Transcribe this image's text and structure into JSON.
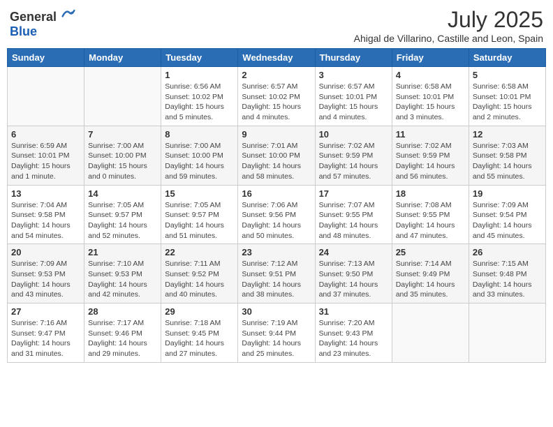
{
  "logo": {
    "general": "General",
    "blue": "Blue"
  },
  "title": "July 2025",
  "subtitle": "Ahigal de Villarino, Castille and Leon, Spain",
  "days_of_week": [
    "Sunday",
    "Monday",
    "Tuesday",
    "Wednesday",
    "Thursday",
    "Friday",
    "Saturday"
  ],
  "weeks": [
    [
      {
        "day": "",
        "info": ""
      },
      {
        "day": "",
        "info": ""
      },
      {
        "day": "1",
        "info": "Sunrise: 6:56 AM\nSunset: 10:02 PM\nDaylight: 15 hours and 5 minutes."
      },
      {
        "day": "2",
        "info": "Sunrise: 6:57 AM\nSunset: 10:02 PM\nDaylight: 15 hours and 4 minutes."
      },
      {
        "day": "3",
        "info": "Sunrise: 6:57 AM\nSunset: 10:01 PM\nDaylight: 15 hours and 4 minutes."
      },
      {
        "day": "4",
        "info": "Sunrise: 6:58 AM\nSunset: 10:01 PM\nDaylight: 15 hours and 3 minutes."
      },
      {
        "day": "5",
        "info": "Sunrise: 6:58 AM\nSunset: 10:01 PM\nDaylight: 15 hours and 2 minutes."
      }
    ],
    [
      {
        "day": "6",
        "info": "Sunrise: 6:59 AM\nSunset: 10:01 PM\nDaylight: 15 hours and 1 minute."
      },
      {
        "day": "7",
        "info": "Sunrise: 7:00 AM\nSunset: 10:00 PM\nDaylight: 15 hours and 0 minutes."
      },
      {
        "day": "8",
        "info": "Sunrise: 7:00 AM\nSunset: 10:00 PM\nDaylight: 14 hours and 59 minutes."
      },
      {
        "day": "9",
        "info": "Sunrise: 7:01 AM\nSunset: 10:00 PM\nDaylight: 14 hours and 58 minutes."
      },
      {
        "day": "10",
        "info": "Sunrise: 7:02 AM\nSunset: 9:59 PM\nDaylight: 14 hours and 57 minutes."
      },
      {
        "day": "11",
        "info": "Sunrise: 7:02 AM\nSunset: 9:59 PM\nDaylight: 14 hours and 56 minutes."
      },
      {
        "day": "12",
        "info": "Sunrise: 7:03 AM\nSunset: 9:58 PM\nDaylight: 14 hours and 55 minutes."
      }
    ],
    [
      {
        "day": "13",
        "info": "Sunrise: 7:04 AM\nSunset: 9:58 PM\nDaylight: 14 hours and 54 minutes."
      },
      {
        "day": "14",
        "info": "Sunrise: 7:05 AM\nSunset: 9:57 PM\nDaylight: 14 hours and 52 minutes."
      },
      {
        "day": "15",
        "info": "Sunrise: 7:05 AM\nSunset: 9:57 PM\nDaylight: 14 hours and 51 minutes."
      },
      {
        "day": "16",
        "info": "Sunrise: 7:06 AM\nSunset: 9:56 PM\nDaylight: 14 hours and 50 minutes."
      },
      {
        "day": "17",
        "info": "Sunrise: 7:07 AM\nSunset: 9:55 PM\nDaylight: 14 hours and 48 minutes."
      },
      {
        "day": "18",
        "info": "Sunrise: 7:08 AM\nSunset: 9:55 PM\nDaylight: 14 hours and 47 minutes."
      },
      {
        "day": "19",
        "info": "Sunrise: 7:09 AM\nSunset: 9:54 PM\nDaylight: 14 hours and 45 minutes."
      }
    ],
    [
      {
        "day": "20",
        "info": "Sunrise: 7:09 AM\nSunset: 9:53 PM\nDaylight: 14 hours and 43 minutes."
      },
      {
        "day": "21",
        "info": "Sunrise: 7:10 AM\nSunset: 9:53 PM\nDaylight: 14 hours and 42 minutes."
      },
      {
        "day": "22",
        "info": "Sunrise: 7:11 AM\nSunset: 9:52 PM\nDaylight: 14 hours and 40 minutes."
      },
      {
        "day": "23",
        "info": "Sunrise: 7:12 AM\nSunset: 9:51 PM\nDaylight: 14 hours and 38 minutes."
      },
      {
        "day": "24",
        "info": "Sunrise: 7:13 AM\nSunset: 9:50 PM\nDaylight: 14 hours and 37 minutes."
      },
      {
        "day": "25",
        "info": "Sunrise: 7:14 AM\nSunset: 9:49 PM\nDaylight: 14 hours and 35 minutes."
      },
      {
        "day": "26",
        "info": "Sunrise: 7:15 AM\nSunset: 9:48 PM\nDaylight: 14 hours and 33 minutes."
      }
    ],
    [
      {
        "day": "27",
        "info": "Sunrise: 7:16 AM\nSunset: 9:47 PM\nDaylight: 14 hours and 31 minutes."
      },
      {
        "day": "28",
        "info": "Sunrise: 7:17 AM\nSunset: 9:46 PM\nDaylight: 14 hours and 29 minutes."
      },
      {
        "day": "29",
        "info": "Sunrise: 7:18 AM\nSunset: 9:45 PM\nDaylight: 14 hours and 27 minutes."
      },
      {
        "day": "30",
        "info": "Sunrise: 7:19 AM\nSunset: 9:44 PM\nDaylight: 14 hours and 25 minutes."
      },
      {
        "day": "31",
        "info": "Sunrise: 7:20 AM\nSunset: 9:43 PM\nDaylight: 14 hours and 23 minutes."
      },
      {
        "day": "",
        "info": ""
      },
      {
        "day": "",
        "info": ""
      }
    ]
  ]
}
